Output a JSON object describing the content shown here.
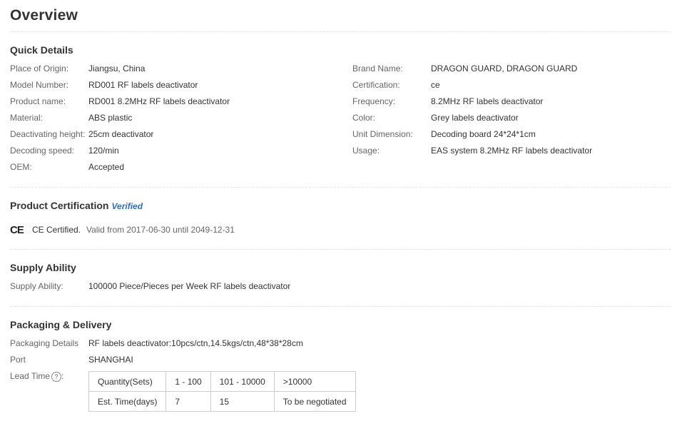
{
  "overview": {
    "title": "Overview"
  },
  "quick_details": {
    "title": "Quick Details",
    "left": [
      {
        "label": "Place of Origin:",
        "value": "Jiangsu, China"
      },
      {
        "label": "Model Number:",
        "value": "RD001 RF labels deactivator"
      },
      {
        "label": "Product name:",
        "value": "RD001 8.2MHz RF labels deactivator"
      },
      {
        "label": "Material:",
        "value": "ABS plastic"
      },
      {
        "label": "Deactivating height:",
        "value": "25cm deactivator"
      },
      {
        "label": "Decoding speed:",
        "value": "120/min"
      },
      {
        "label": "OEM:",
        "value": "Accepted"
      }
    ],
    "right": [
      {
        "label": "Brand Name:",
        "value": "DRAGON GUARD, DRAGON GUARD"
      },
      {
        "label": "Certification:",
        "value": "ce"
      },
      {
        "label": "Frequency:",
        "value": "8.2MHz RF labels deactivator"
      },
      {
        "label": "Color:",
        "value": "Grey labels deactivator"
      },
      {
        "label": "Unit Dimension:",
        "value": "Decoding board 24*24*1cm"
      },
      {
        "label": "Usage:",
        "value": "EAS system 8.2MHz RF labels deactivator"
      }
    ]
  },
  "certification": {
    "title": "Product Certification",
    "verified": "Verified",
    "logo": "CE",
    "name": "CE Certified.",
    "valid": "Valid from 2017-06-30 until 2049-12-31"
  },
  "supply": {
    "title": "Supply Ability",
    "label": "Supply Ability:",
    "value": "100000 Piece/Pieces per Week RF labels deactivator"
  },
  "packaging": {
    "title": "Packaging & Delivery",
    "details_label": "Packaging Details",
    "details_value": "RF labels deactivator:10pcs/ctn,14.5kgs/ctn,48*38*28cm",
    "port_label": "Port",
    "port_value": "SHANGHAI",
    "lead_label": "Lead Time",
    "help_icon": "?",
    "lead_table": {
      "header": [
        "Quantity(Sets)",
        "1 - 100",
        "101 - 10000",
        ">10000"
      ],
      "row": [
        "Est. Time(days)",
        "7",
        "15",
        "To be negotiated"
      ]
    }
  }
}
